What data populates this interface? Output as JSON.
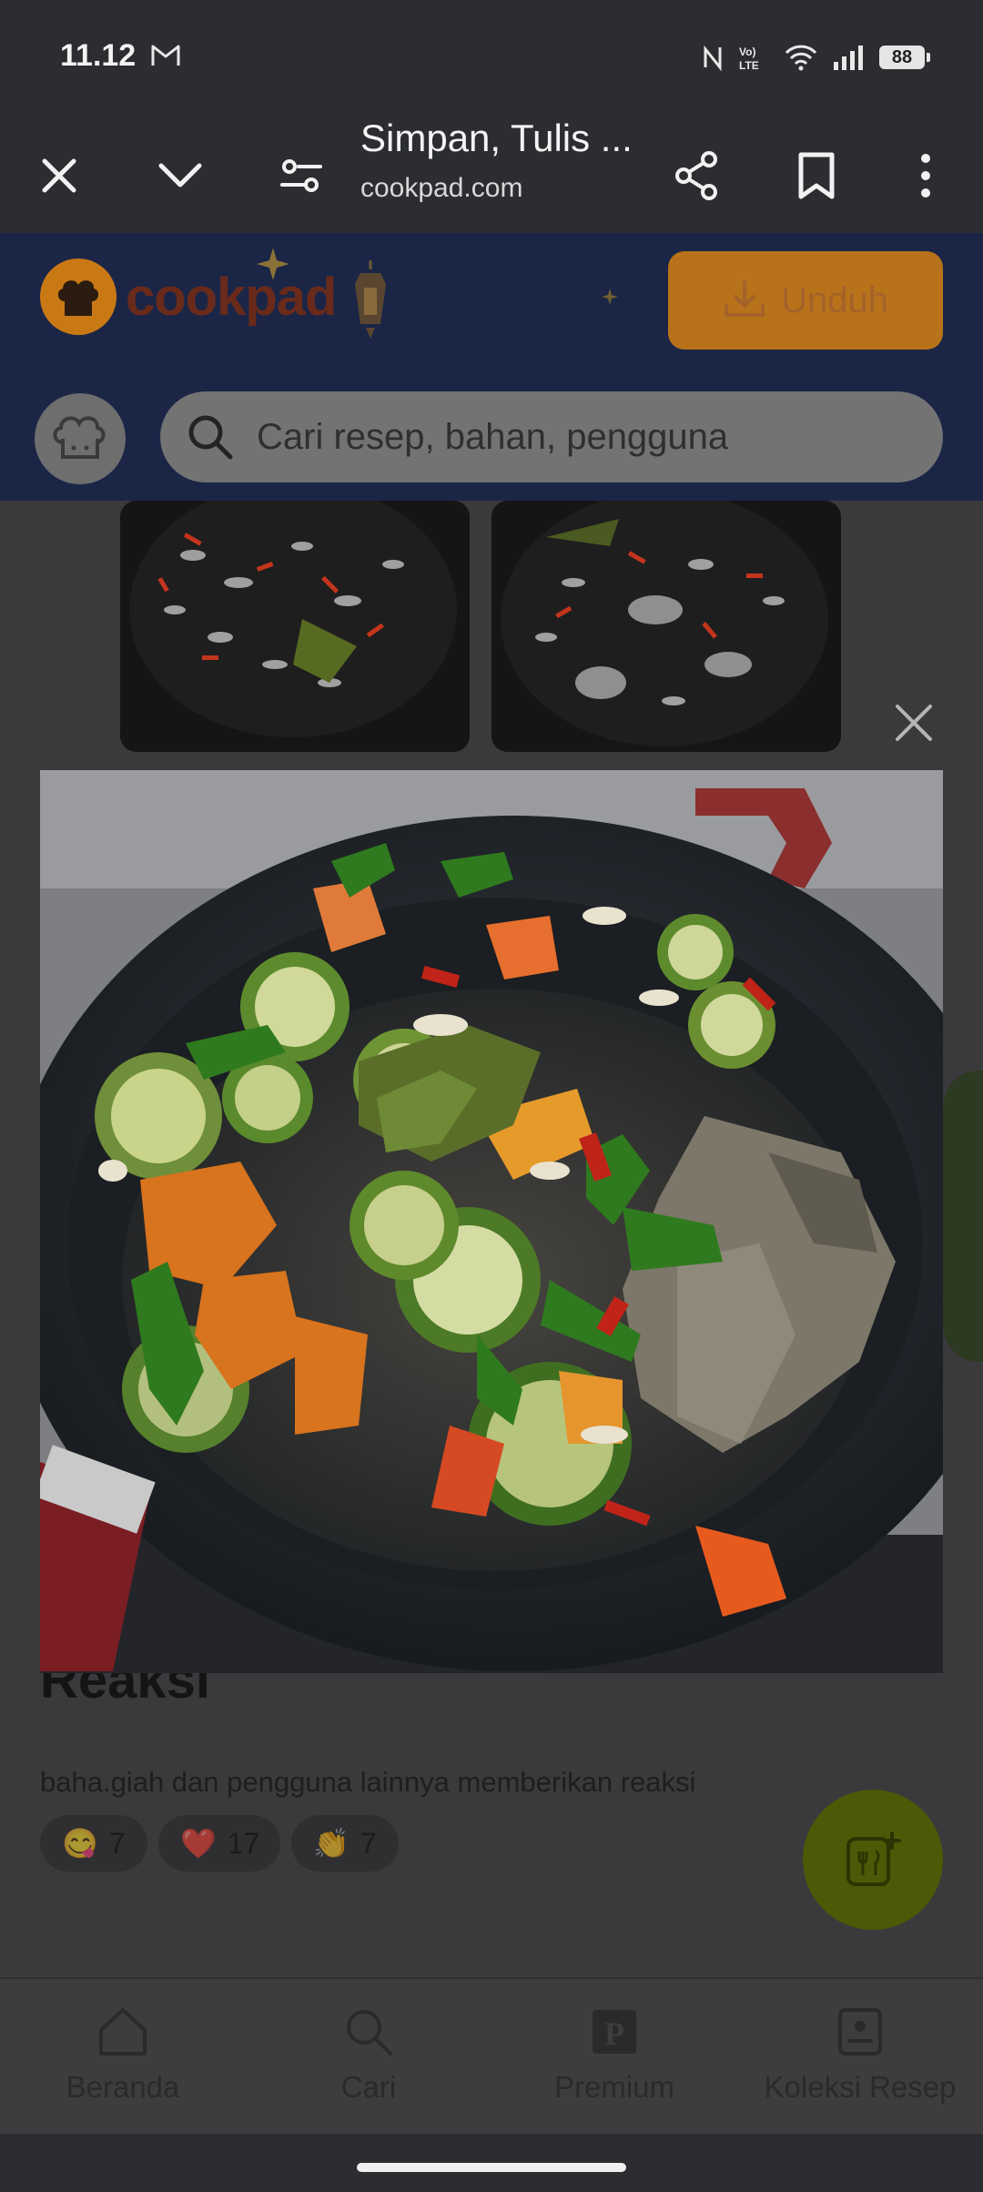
{
  "status_bar": {
    "time": "11.12",
    "battery": "88"
  },
  "browser": {
    "title": "Simpan, Tulis ...",
    "domain": "cookpad.com"
  },
  "site": {
    "logo_text": "cookpad",
    "download_label": "Unduh",
    "search_placeholder": "Cari resep, bahan, pengguna"
  },
  "reactions": {
    "title": "Reaksi",
    "description": "baha.giah dan pengguna lainnya memberikan reaksi",
    "items": [
      {
        "emoji": "😋",
        "count": "7"
      },
      {
        "emoji": "❤️",
        "count": "17"
      },
      {
        "emoji": "👏",
        "count": "7"
      }
    ]
  },
  "bottom_nav": [
    {
      "label": "Beranda",
      "icon": "home-icon"
    },
    {
      "label": "Cari",
      "icon": "search-icon"
    },
    {
      "label": "Premium",
      "icon": "premium-icon"
    },
    {
      "label": "Koleksi Resep",
      "icon": "recipe-collection-icon"
    }
  ]
}
